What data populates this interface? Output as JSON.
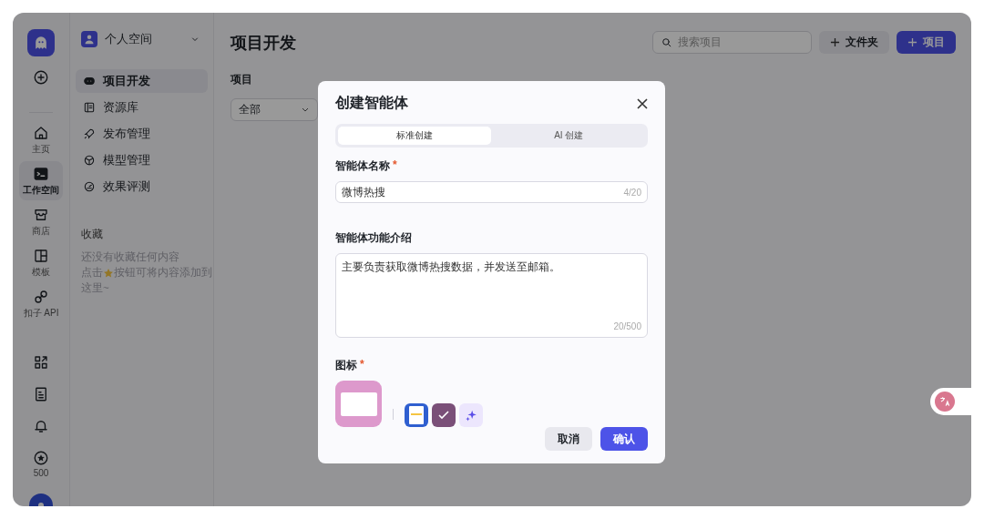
{
  "rail": {
    "top": [
      {
        "kind": "add"
      }
    ],
    "items": [
      {
        "kind": "home",
        "label": "主页",
        "selected": false
      },
      {
        "kind": "workspace",
        "label": "工作空间",
        "selected": true
      },
      {
        "kind": "store",
        "label": "商店",
        "selected": false
      },
      {
        "kind": "template",
        "label": "模板",
        "selected": false
      },
      {
        "kind": "api",
        "label": "扣子 API",
        "selected": false
      }
    ],
    "bottom": [
      {
        "kind": "apps"
      },
      {
        "kind": "doc"
      },
      {
        "kind": "bell"
      },
      {
        "kind": "points",
        "label": "500"
      }
    ]
  },
  "sidebar": {
    "workspace": "个人空间",
    "items": [
      {
        "kind": "bot",
        "label": "项目开发",
        "selected": true
      },
      {
        "kind": "library",
        "label": "资源库",
        "selected": false
      },
      {
        "kind": "publish",
        "label": "发布管理",
        "selected": false
      },
      {
        "kind": "model",
        "label": "模型管理",
        "selected": false
      },
      {
        "kind": "eval",
        "label": "效果评测",
        "selected": false
      }
    ],
    "favorites": {
      "title": "收藏",
      "empty": "还没有收藏任何内容",
      "hint_before": "点击",
      "hint_after": "按钮可将内容添加到",
      "hint_tail": "这里~"
    }
  },
  "main": {
    "title": "项目开发",
    "search": {
      "placeholder": "搜索项目"
    },
    "buttons": [
      {
        "kind": "secondary",
        "label": "文件夹"
      },
      {
        "kind": "primary",
        "label": "项目"
      }
    ],
    "filter": {
      "label": "项目",
      "value": "全部"
    }
  },
  "dialog": {
    "title": "创建智能体",
    "tabs": [
      {
        "label": "标准创建",
        "selected": true
      },
      {
        "label": "AI 创建",
        "selected": false
      }
    ],
    "name": {
      "label": "智能体名称",
      "required_mark": "*",
      "value": "微博热搜",
      "count": "4/20"
    },
    "description": {
      "label": "智能体功能介绍",
      "value": "主要负责获取微博热搜数据，并发送至邮箱。",
      "count": "20/500"
    },
    "icon": {
      "label": "图标",
      "required_mark": "*",
      "options": [
        {
          "color": "#2f5fd0",
          "selected": false
        },
        {
          "color": "#7a4f78",
          "selected": true
        }
      ]
    },
    "buttons": [
      {
        "kind": "secondary",
        "label": "取消"
      },
      {
        "kind": "primary",
        "label": "确认"
      }
    ]
  }
}
